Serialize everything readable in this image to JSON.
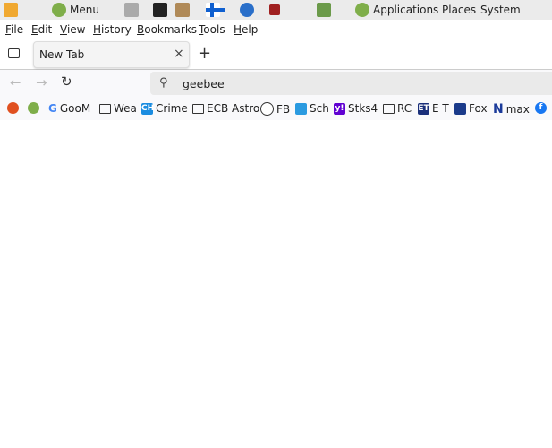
{
  "panel": {
    "menu_label": "Menu",
    "applications": "Applications",
    "places": "Places",
    "system": "System"
  },
  "menubar": [
    "File",
    "Edit",
    "View",
    "History",
    "Bookmarks",
    "Tools",
    "Help"
  ],
  "tabs": [
    {
      "label": "New Tab",
      "active": true
    }
  ],
  "urlbar": {
    "value": "geebee"
  },
  "bookmarks": [
    "GooM",
    "Wea",
    "Crime",
    "ECB Astro",
    "FB",
    "Sch",
    "Stks4",
    "RC",
    "E T",
    "Fox",
    "max"
  ]
}
